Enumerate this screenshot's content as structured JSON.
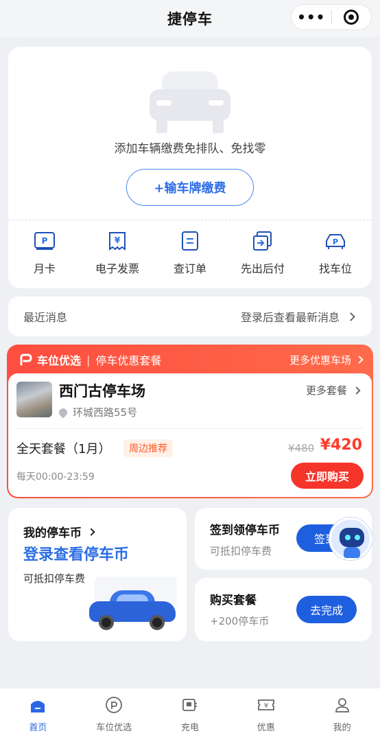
{
  "header": {
    "title": "捷停车",
    "more_glyph": "•••"
  },
  "vehicle_card": {
    "hint": "添加车辆缴费免排队、免找零",
    "plate_button": "+输车牌缴费",
    "quick_actions": [
      {
        "label": "月卡",
        "icon": "parking-card-icon"
      },
      {
        "label": "电子发票",
        "icon": "invoice-icon"
      },
      {
        "label": "查订单",
        "icon": "order-icon"
      },
      {
        "label": "先出后付",
        "icon": "exit-pay-icon"
      },
      {
        "label": "找车位",
        "icon": "find-spot-icon"
      }
    ]
  },
  "messages": {
    "label": "最近消息",
    "action": "登录后查看最新消息"
  },
  "promo": {
    "brand": "车位优选",
    "subtitle": "停车优惠套餐",
    "more_lots": "更多优惠车场",
    "lot_name": "西门古停车场",
    "lot_address": "环城西路55号",
    "more_packages": "更多套餐",
    "package_name": "全天套餐（1月）",
    "tag": "周边推荐",
    "original_price": "¥480",
    "price": "¥420",
    "hours": "每天00:00-23:59",
    "buy_button": "立即购买",
    "accent_color": "#ff4d3f"
  },
  "coins": {
    "title": "我的停车币",
    "login_text": "登录查看停车币",
    "subtitle": "可抵扣停车费"
  },
  "sign_in": {
    "title": "签到领停车币",
    "subtitle": "可抵扣停车费",
    "button": "签到"
  },
  "buy_package": {
    "title": "购买套餐",
    "subtitle": "+200停车币",
    "button": "去完成"
  },
  "tabbar": {
    "items": [
      {
        "label": "首页",
        "active": true
      },
      {
        "label": "车位优选",
        "active": false
      },
      {
        "label": "充电",
        "active": false
      },
      {
        "label": "优惠",
        "active": false
      },
      {
        "label": "我的",
        "active": false
      }
    ],
    "active_color": "#2a66e6"
  }
}
